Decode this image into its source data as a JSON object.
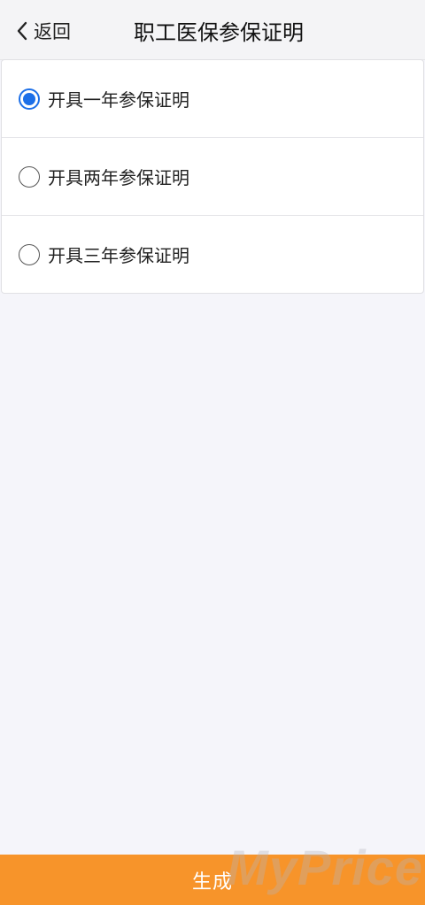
{
  "header": {
    "back_label": "返回",
    "title": "职工医保参保证明"
  },
  "options": [
    {
      "label": "开具一年参保证明",
      "checked": true
    },
    {
      "label": "开具两年参保证明",
      "checked": false
    },
    {
      "label": "开具三年参保证明",
      "checked": false
    }
  ],
  "footer": {
    "button_label": "生成"
  },
  "watermark": "MyPrice",
  "colors": {
    "accent": "#1c6fe8",
    "footer_bg": "#f7942a",
    "page_bg": "#f5f5fa"
  }
}
